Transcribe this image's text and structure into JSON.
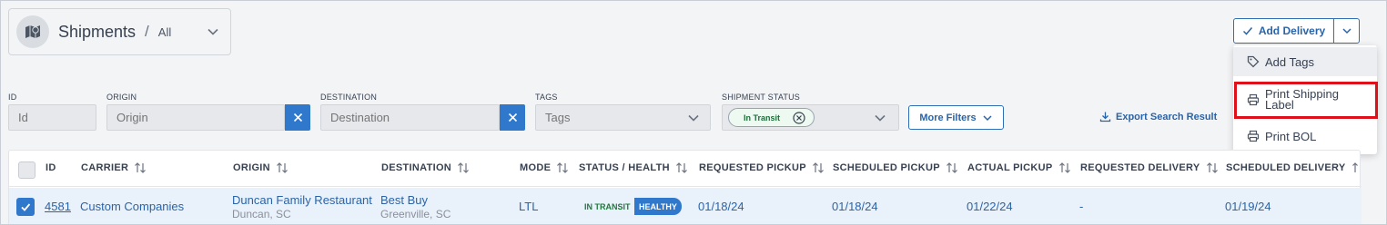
{
  "header": {
    "title": "Shipments",
    "separator": "/",
    "view": "All"
  },
  "actions": {
    "add_delivery": "Add Delivery",
    "menu": {
      "add_tags": "Add Tags",
      "print_shipping_label": "Print Shipping Label",
      "print_bol": "Print BOL"
    }
  },
  "filters": {
    "id": {
      "label": "ID",
      "placeholder": "Id"
    },
    "origin": {
      "label": "ORIGIN",
      "placeholder": "Origin"
    },
    "destination": {
      "label": "DESTINATION",
      "placeholder": "Destination"
    },
    "tags": {
      "label": "TAGS",
      "placeholder": "Tags"
    },
    "shipment_status": {
      "label": "SHIPMENT STATUS",
      "chip": "In Transit"
    },
    "more_filters": "More Filters",
    "export": "Export Search Result"
  },
  "table": {
    "columns": [
      "ID",
      "CARRIER",
      "ORIGIN",
      "DESTINATION",
      "MODE",
      "STATUS / HEALTH",
      "REQUESTED PICKUP",
      "SCHEDULED PICKUP",
      "ACTUAL PICKUP",
      "REQUESTED DELIVERY",
      "SCHEDULED DELIVERY"
    ],
    "rows": [
      {
        "id": "4581",
        "carrier": "Custom Companies",
        "origin_name": "Duncan Family Restaurant",
        "origin_city": "Duncan, SC",
        "destination_name": "Best Buy",
        "destination_city": "Greenville, SC",
        "mode": "LTL",
        "status": "IN TRANSIT",
        "health": "HEALTHY",
        "requested_pickup": "01/18/24",
        "scheduled_pickup": "01/18/24",
        "actual_pickup": "01/22/24",
        "requested_delivery": "-",
        "scheduled_delivery": "01/19/24"
      }
    ]
  },
  "colors": {
    "accent": "#2f78cc",
    "highlight": "#e0101b",
    "status_green": "#1d7a3a"
  },
  "icons": [
    "map-icon",
    "chevron-down-icon",
    "check-icon",
    "tag-icon",
    "printer-icon",
    "close-icon",
    "x-circle-icon",
    "download-icon",
    "sort-icon",
    "checkbox-icon"
  ]
}
